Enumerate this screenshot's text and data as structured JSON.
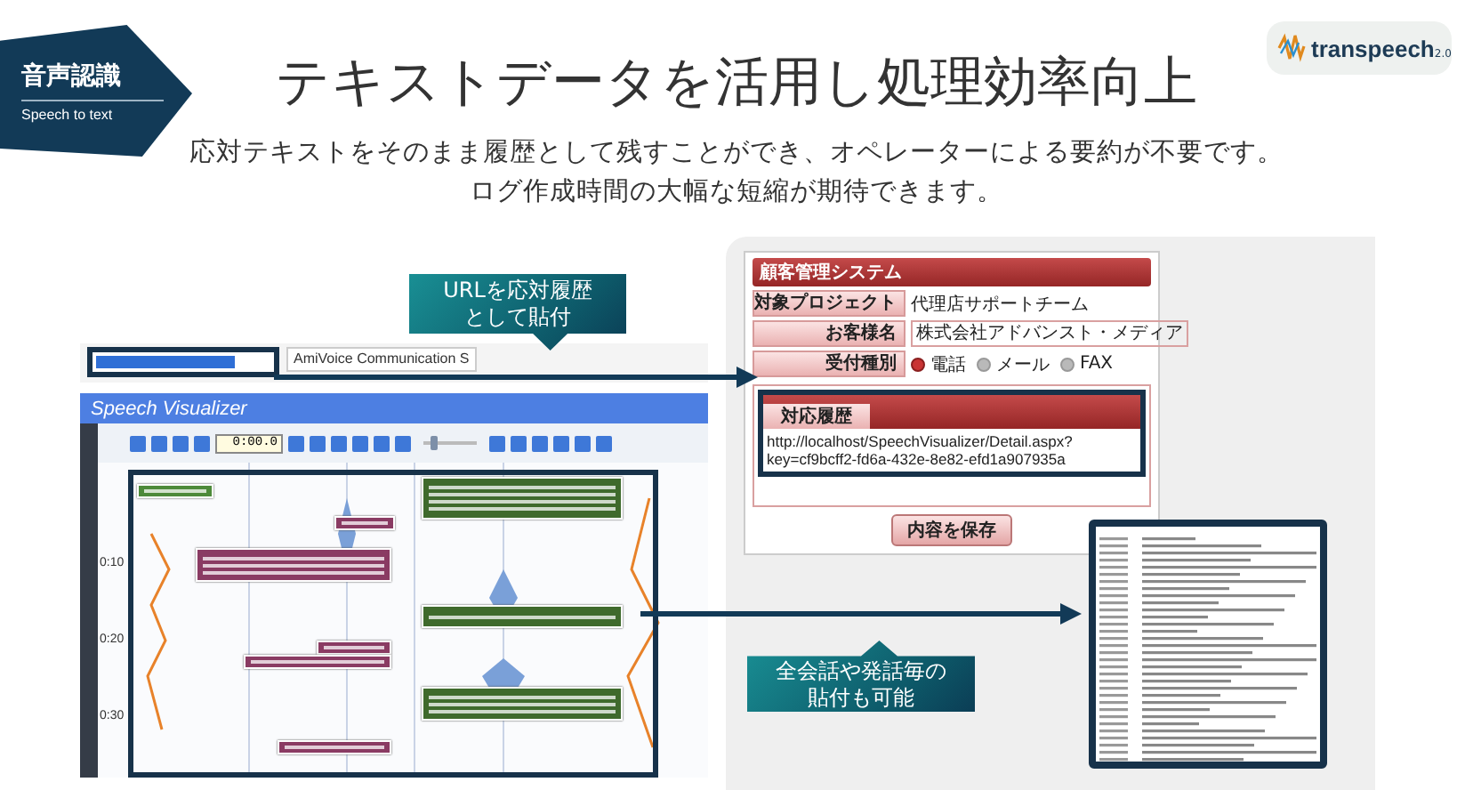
{
  "banner": {
    "title": "音声認識",
    "subtitle": "Speech to text"
  },
  "logo": {
    "text": "transpeech",
    "version": "2.0"
  },
  "title": "テキストデータを活用し処理効率向上",
  "description": [
    "応対テキストをそのまま履歴として残すことができ、オペレーターによる要約が不要です。",
    "ログ作成時間の大幅な短縮が期待できます。"
  ],
  "callouts": [
    {
      "lines": [
        "URLを応対履歴",
        "として貼付"
      ]
    },
    {
      "lines": [
        "全会話や発話毎の",
        "貼付も可能"
      ]
    }
  ],
  "browser": {
    "tab": "AmiVoice Communication S"
  },
  "visualizer": {
    "app_name": "Speech Visualizer",
    "time": "0:00.0",
    "volume": {
      "level": 0.2
    },
    "time_marks": [
      "0:10",
      "0:20",
      "0:30"
    ],
    "bubbles": [
      {
        "kind": "event"
      },
      {
        "kind": "operator"
      },
      {
        "kind": "customer"
      },
      {
        "kind": "customer"
      },
      {
        "kind": "operator"
      },
      {
        "kind": "customer"
      },
      {
        "kind": "customer"
      },
      {
        "kind": "operator"
      },
      {
        "kind": "customer"
      }
    ]
  },
  "crm": {
    "title": "顧客管理システム",
    "fields": [
      {
        "kind": "text",
        "label": "対象プロジェクト",
        "value": "代理店サポートチーム"
      },
      {
        "kind": "input",
        "label": "お客様名",
        "value": "株式会社アドバンスト・メディア"
      },
      {
        "kind": "radio",
        "label": "受付種別",
        "options": [
          {
            "label": "電話",
            "selected": true
          },
          {
            "label": "メール",
            "selected": false
          },
          {
            "label": "FAX",
            "selected": false
          }
        ]
      }
    ],
    "history": {
      "title": "対応履歴",
      "value": "http://localhost/SpeechVisualizer/Detail.aspx?key=cf9bcff2-fd6a-432e-8e82-efd1a907935a"
    },
    "save_button": "内容を保存"
  }
}
